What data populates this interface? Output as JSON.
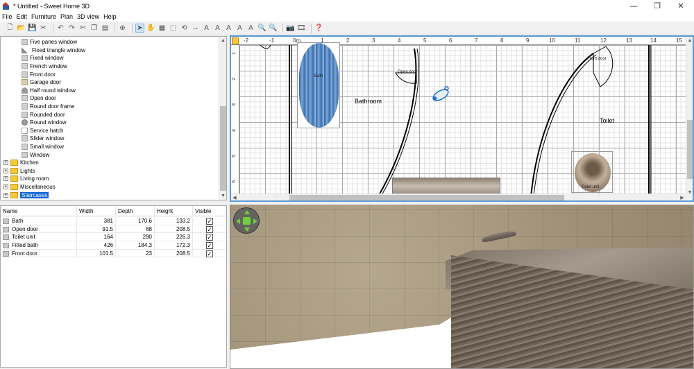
{
  "window": {
    "title": "* Untitled - Sweet Home 3D",
    "minimize": "—",
    "maximize": "❐",
    "close": "✕"
  },
  "menu": [
    "File",
    "Edit",
    "Furniture",
    "Plan",
    "3D view",
    "Help"
  ],
  "toolbar_icons": [
    "new-icon",
    "open-icon",
    "save-icon",
    "cut-preferences-icon",
    "undo-icon",
    "redo-icon",
    "cut-icon",
    "copy-icon",
    "paste-icon",
    "add-furniture-icon",
    "select-icon",
    "pan-icon",
    "create-walls-icon",
    "create-rooms-icon",
    "create-polylines-icon",
    "create-dimensions-icon",
    "add-text-icon",
    "increase-text-icon",
    "decrease-text-icon",
    "bold-text-icon",
    "italic-text-icon",
    "zoom-in-icon",
    "zoom-out-icon",
    "create-photo-icon",
    "create-video-icon",
    "help-icon"
  ],
  "tree": {
    "items": [
      {
        "label": "Five panes window",
        "type": "item"
      },
      {
        "label": "Fixed triangle window",
        "type": "item"
      },
      {
        "label": "Fixed window",
        "type": "item"
      },
      {
        "label": "French window",
        "type": "item"
      },
      {
        "label": "Front door",
        "type": "item"
      },
      {
        "label": "Garage door",
        "type": "item"
      },
      {
        "label": "Half round window",
        "type": "item"
      },
      {
        "label": "Open door",
        "type": "item"
      },
      {
        "label": "Round door frame",
        "type": "item"
      },
      {
        "label": "Rounded door",
        "type": "item"
      },
      {
        "label": "Round window",
        "type": "item"
      },
      {
        "label": "Service hatch",
        "type": "item"
      },
      {
        "label": "Slider window",
        "type": "item"
      },
      {
        "label": "Small window",
        "type": "item"
      },
      {
        "label": "Window",
        "type": "item"
      },
      {
        "label": "Kitchen",
        "type": "folder"
      },
      {
        "label": "Lights",
        "type": "folder"
      },
      {
        "label": "Living room",
        "type": "folder"
      },
      {
        "label": "Miscellaneous",
        "type": "folder"
      },
      {
        "label": "Staircases",
        "type": "folder",
        "selected": true
      }
    ]
  },
  "furniture_table": {
    "columns": [
      "Name",
      "Width",
      "Depth",
      "Height",
      "Visible"
    ],
    "rows": [
      {
        "name": "Bath",
        "width": "381",
        "depth": "170.6",
        "height": "133.2",
        "visible": "✓"
      },
      {
        "name": "Open door",
        "width": "91.5",
        "depth": "68",
        "height": "208.5",
        "visible": "✓"
      },
      {
        "name": "Toilet unit",
        "width": "164",
        "depth": "290",
        "height": "226.3",
        "visible": "✓"
      },
      {
        "name": "Fitted bath",
        "width": "426",
        "depth": "184.3",
        "height": "172.3",
        "visible": "✓"
      },
      {
        "name": "Front door",
        "width": "101.5",
        "depth": "23",
        "height": "208.5",
        "visible": "✓"
      }
    ]
  },
  "plan": {
    "ruler_x": [
      "-2",
      "-1",
      "0m",
      "1",
      "2",
      "3",
      "4",
      "5",
      "6",
      "7",
      "8",
      "9",
      "10",
      "11",
      "12",
      "13",
      "14",
      "15"
    ],
    "ruler_y": [
      "1",
      "2",
      "3",
      "4",
      "5",
      "6"
    ],
    "rooms": {
      "bathroom": "Bathroom",
      "toilet": "Toilet"
    },
    "labels": {
      "bath": "Bath",
      "open_door": "Open door",
      "front_door": "Front door",
      "toilet_unit": "Toilet unit"
    }
  }
}
